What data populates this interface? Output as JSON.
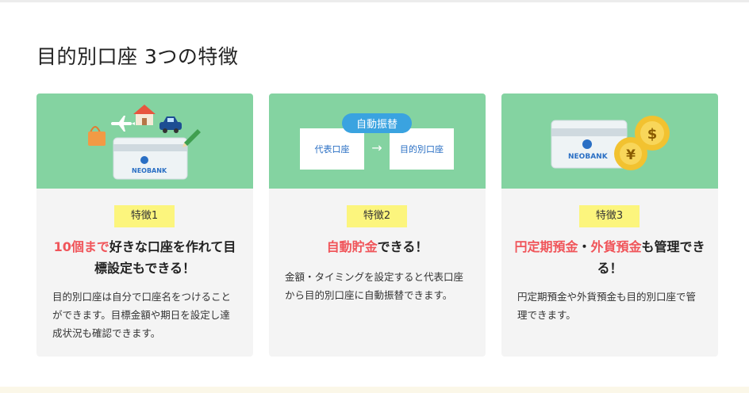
{
  "page": {
    "title": "目的別口座 3つの特徴"
  },
  "colors": {
    "hero_bg": "#84d3a1",
    "badge_bg": "#fcf57d",
    "highlight": "#f0555a",
    "card_bg": "#f4f4f4",
    "transfer_pill": "#3aa3e0"
  },
  "cards": [
    {
      "badge": "特徴1",
      "heading_hl": "10個まで",
      "heading_rest": "好きな口座を作れて目標設定もできる！",
      "body": "目的別口座は自分で口座名をつけることができます。目標金額や期日を設定し達成状況も確認できます。",
      "illustration": {
        "card_brand": "NEOBANK",
        "icons": [
          "shopping-bag-icon",
          "airplane-icon",
          "house-icon",
          "car-icon",
          "pencil-icon",
          "bank-card-icon"
        ]
      }
    },
    {
      "badge": "特徴2",
      "heading_hl": "自動貯金",
      "heading_rest": "できる！",
      "body": "金額・タイミングを設定すると代表口座から目的別口座に自動振替できます。",
      "illustration": {
        "pill": "自動振替",
        "from_box": "代表口座",
        "arrow": "→",
        "to_box": "目的別口座"
      }
    },
    {
      "badge": "特徴3",
      "heading_hl1": "円定期預金",
      "heading_sep": "・",
      "heading_hl2": "外貨預金",
      "heading_rest": "も管理できる！",
      "body": "円定期預金や外貨預金も目的別口座で管理できます。",
      "illustration": {
        "card_brand": "NEOBANK",
        "coin_1": "$",
        "coin_2": "¥"
      }
    }
  ]
}
